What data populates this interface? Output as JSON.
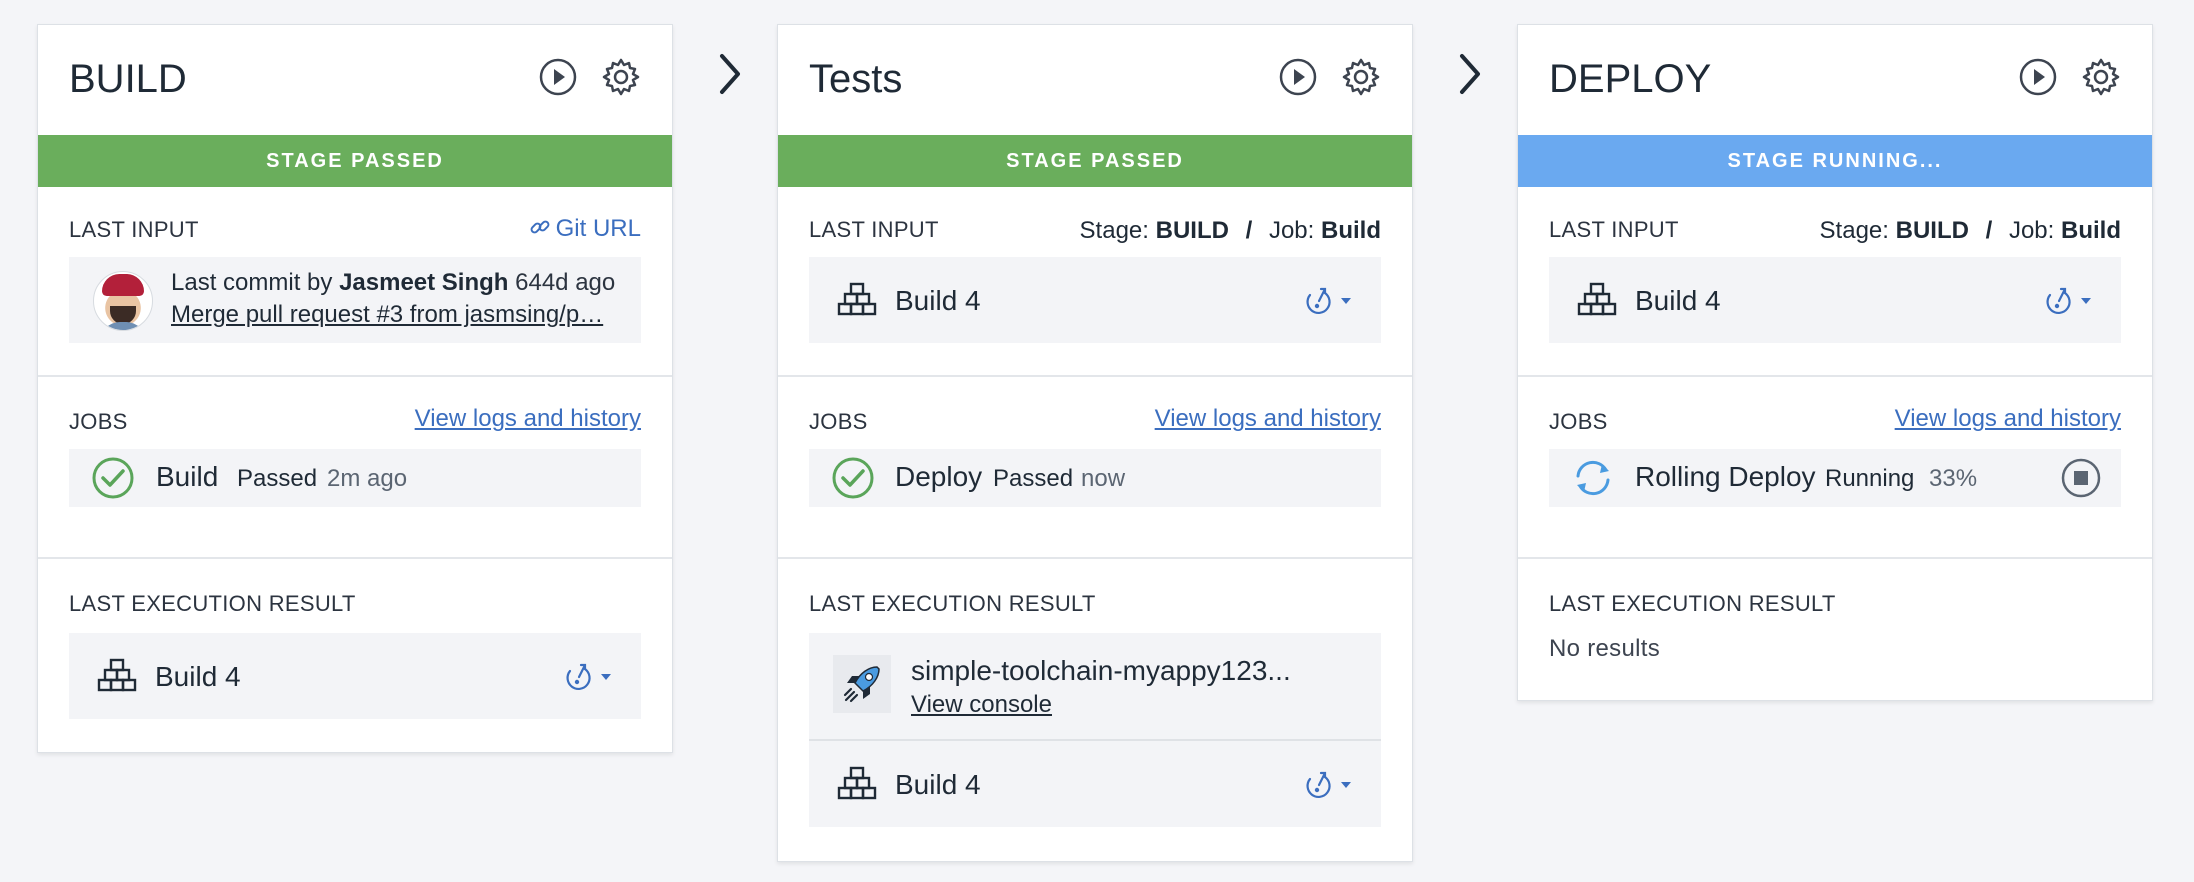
{
  "stages": [
    {
      "title": "BUILD",
      "banner": "STAGE PASSED",
      "last_input": {
        "label": "LAST INPUT",
        "link": "Git URL",
        "commit_prefix": "Last commit by",
        "author": "Jasmeet Singh",
        "age": "644d ago",
        "message": "Merge pull request #3 from jasmsing/p…"
      },
      "jobs": {
        "label": "JOBS",
        "link": "View logs and history",
        "name": "Build",
        "status": "Passed",
        "time": "2m ago"
      },
      "last_execution": {
        "label": "LAST EXECUTION RESULT",
        "build": "Build 4"
      }
    },
    {
      "title": "Tests",
      "banner": "STAGE PASSED",
      "last_input": {
        "label": "LAST INPUT",
        "stage_label": "Stage:",
        "stage_value": "BUILD",
        "sep": "/",
        "job_label": "Job:",
        "job_value": "Build",
        "build": "Build 4"
      },
      "jobs": {
        "label": "JOBS",
        "link": "View logs and history",
        "name": "Deploy",
        "status": "Passed",
        "time": "now"
      },
      "last_execution": {
        "label": "LAST EXECUTION RESULT",
        "app_name": "simple-toolchain-myappy123...",
        "console_link": "View console",
        "build": "Build 4"
      }
    },
    {
      "title": "DEPLOY",
      "banner": "STAGE RUNNING...",
      "last_input": {
        "label": "LAST INPUT",
        "stage_label": "Stage:",
        "stage_value": "BUILD",
        "sep": "/",
        "job_label": "Job:",
        "job_value": "Build",
        "build": "Build 4"
      },
      "jobs": {
        "label": "JOBS",
        "link": "View logs and history",
        "name": "Rolling Deploy",
        "status": "Running",
        "progress": "33%"
      },
      "last_execution": {
        "label": "LAST EXECUTION RESULT",
        "empty": "No results"
      }
    }
  ],
  "colors": {
    "passed": "#6aae5c",
    "running": "#6aa9f0",
    "link": "#3b6ebf"
  },
  "icons": [
    "run-stage-icon",
    "settings-gear-icon",
    "link-icon",
    "build-artifact-icon",
    "deploy-menu-icon",
    "check-circle-icon",
    "refresh-running-icon",
    "stop-icon",
    "rocket-icon",
    "chevron-right-icon"
  ]
}
